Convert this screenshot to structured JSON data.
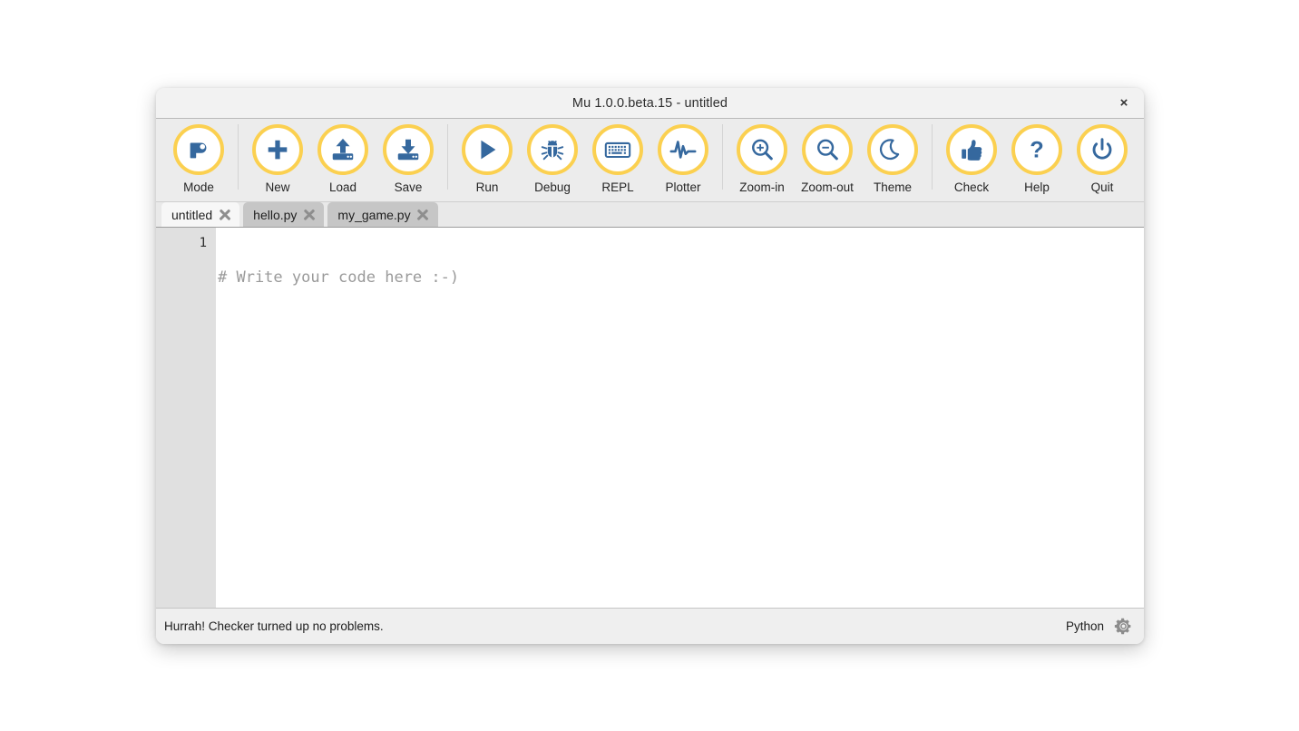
{
  "window": {
    "title": "Mu 1.0.0.beta.15 - untitled",
    "close_label": "×"
  },
  "theme": {
    "ring_color": "#fbd050",
    "icon_color": "#35689e",
    "toolbar_bg": "#ececec",
    "titlebar_bg": "#f2f2f2",
    "editor_bg": "#ffffff",
    "gutter_bg": "#e0e0e0",
    "active_tab_bg": "#f7f7f7",
    "inactive_tab_bg": "#c6c6c6",
    "comment_color": "#9a9a9a"
  },
  "toolbar": {
    "groups": [
      {
        "items": [
          {
            "label": "Mode",
            "icon": "mode-snake-icon"
          }
        ]
      },
      {
        "items": [
          {
            "label": "New",
            "icon": "plus-icon"
          },
          {
            "label": "Load",
            "icon": "upload-drive-icon"
          },
          {
            "label": "Save",
            "icon": "download-drive-icon"
          }
        ]
      },
      {
        "items": [
          {
            "label": "Run",
            "icon": "play-icon"
          },
          {
            "label": "Debug",
            "icon": "bug-icon"
          },
          {
            "label": "REPL",
            "icon": "keyboard-icon"
          },
          {
            "label": "Plotter",
            "icon": "waveform-icon"
          }
        ]
      },
      {
        "items": [
          {
            "label": "Zoom-in",
            "icon": "magnifier-plus-icon"
          },
          {
            "label": "Zoom-out",
            "icon": "magnifier-minus-icon"
          },
          {
            "label": "Theme",
            "icon": "moon-icon"
          }
        ]
      },
      {
        "items": [
          {
            "label": "Check",
            "icon": "thumbs-up-icon"
          },
          {
            "label": "Help",
            "icon": "question-mark-icon"
          },
          {
            "label": "Quit",
            "icon": "power-icon"
          }
        ]
      }
    ]
  },
  "tabs": [
    {
      "label": "untitled",
      "active": true
    },
    {
      "label": "hello.py",
      "active": false
    },
    {
      "label": "my_game.py",
      "active": false
    }
  ],
  "editor": {
    "line_numbers": [
      "1"
    ],
    "lines": [
      "# Write your code here :-)"
    ]
  },
  "statusbar": {
    "message": "Hurrah! Checker turned up no problems.",
    "mode": "Python",
    "gear_icon": "gear-icon"
  }
}
